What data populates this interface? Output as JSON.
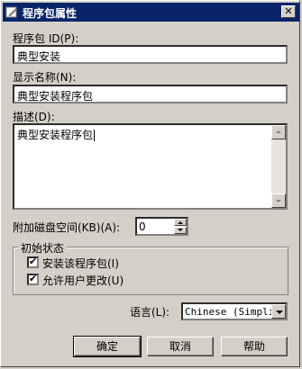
{
  "window": {
    "title": "程序包属性",
    "close_symbol": "✕"
  },
  "fields": {
    "package_id_label": "程序包 ID(P):",
    "package_id_value": "典型安装",
    "display_name_label": "显示名称(N):",
    "display_name_value": "典型安装程序包",
    "description_label": "描述(D):",
    "description_value": "典型安装程序包",
    "disk_space_label": "附加磁盘空间(KB)(A):",
    "disk_space_value": "0"
  },
  "initial_state": {
    "title": "初始状态",
    "install_label": "安装该程序包(I)",
    "install_checked": true,
    "allow_change_label": "允许用户更改(U)",
    "allow_change_checked": true
  },
  "language": {
    "label": "语言(L):",
    "value": "Chinese (Simplif"
  },
  "buttons": {
    "ok": "确定",
    "cancel": "取消",
    "help": "帮助"
  },
  "icons": {
    "title": "package-properties-icon",
    "check": "✔"
  }
}
